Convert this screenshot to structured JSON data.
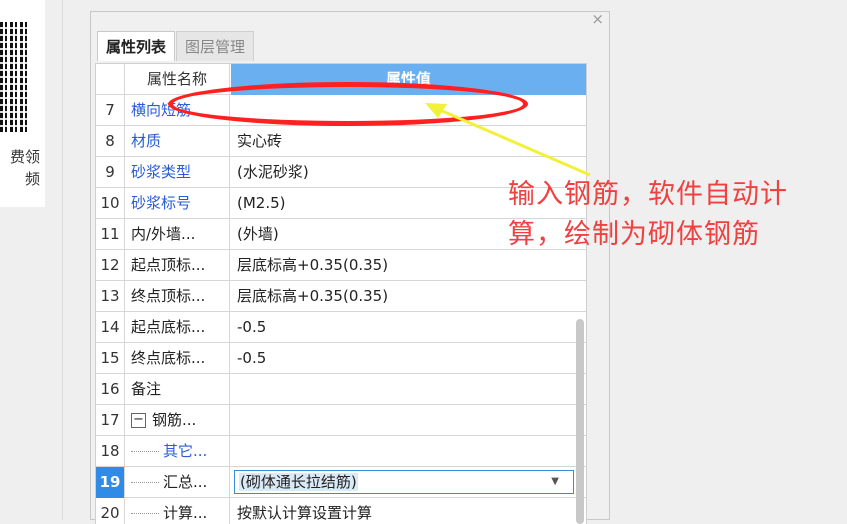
{
  "sidebar": {
    "side_text": "费领\n频"
  },
  "panel": {
    "close_glyph": "×",
    "tabs": [
      {
        "label": "属性列表",
        "active": true
      },
      {
        "label": "图层管理",
        "active": false
      }
    ],
    "headers": {
      "name": "属性名称",
      "value": "属性值"
    },
    "rows": [
      {
        "num": "7",
        "name": "横向短筋",
        "value": "",
        "name_color": "blue"
      },
      {
        "num": "8",
        "name": "材质",
        "value": "实心砖",
        "name_color": "blue"
      },
      {
        "num": "9",
        "name": "砂浆类型",
        "value": "(水泥砂浆)",
        "name_color": "blue"
      },
      {
        "num": "10",
        "name": "砂浆标号",
        "value": "(M2.5)",
        "name_color": "blue"
      },
      {
        "num": "11",
        "name": "内/外墙...",
        "value": "(外墙)"
      },
      {
        "num": "12",
        "name": "起点顶标...",
        "value": "层底标高+0.35(0.35)"
      },
      {
        "num": "13",
        "name": "终点顶标...",
        "value": "层底标高+0.35(0.35)"
      },
      {
        "num": "14",
        "name": "起点底标...",
        "value": "-0.5"
      },
      {
        "num": "15",
        "name": "终点底标...",
        "value": "-0.5"
      },
      {
        "num": "16",
        "name": "备注",
        "value": ""
      },
      {
        "num": "17",
        "name": "钢筋...",
        "value": "",
        "toggle": "−"
      },
      {
        "num": "18",
        "name": "其它...",
        "value": "",
        "name_color": "blue"
      },
      {
        "num": "19",
        "name": "汇总...",
        "value": "(砌体通长拉结筋)",
        "selected": true
      },
      {
        "num": "20",
        "name": "计算...",
        "value": "按默认计算设置计算"
      }
    ]
  },
  "annotation": {
    "line1": "输入钢筋，软件自动计",
    "line2": "算，绘制为砌体钢筋",
    "ellipse_color": "#ff2020",
    "arrow_color": "#f3f03a",
    "text_color": "#f04040"
  },
  "colors": {
    "header_blue": "#6ab0f0",
    "selected_blue": "#2f8be6",
    "link_blue": "#2a5bd7"
  }
}
